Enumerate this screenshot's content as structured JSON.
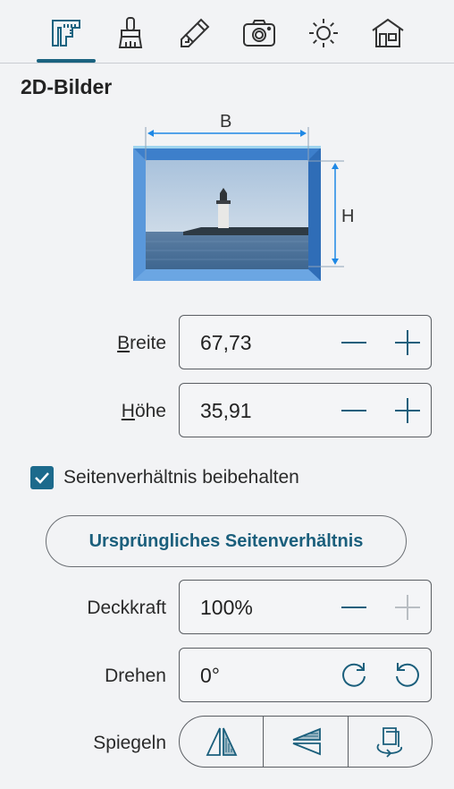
{
  "toolbar": {
    "tabs": [
      {
        "icon": "caliper-ruler-icon",
        "active": true
      },
      {
        "icon": "brush-icon"
      },
      {
        "icon": "pencil-eraser-icon"
      },
      {
        "icon": "camera-icon"
      },
      {
        "icon": "sun-icon"
      },
      {
        "icon": "house-icon"
      }
    ]
  },
  "section_title": "2D-Bilder",
  "preview": {
    "width_label": "B",
    "height_label": "H"
  },
  "width_row": {
    "label_underlined": "B",
    "label_rest": "reite",
    "value": "67,73"
  },
  "height_row": {
    "label_underlined": "H",
    "label_rest": "öhe",
    "value": "35,91"
  },
  "keep_ratio": {
    "label": "Seitenverhältnis beibehalten",
    "checked": true
  },
  "original_ratio_button": "Ursprüngliches Seitenverhältnis",
  "opacity_row": {
    "label": "Deckkraft",
    "value": "100%",
    "plus_disabled": true
  },
  "rotate_row": {
    "label": "Drehen",
    "value": "0°"
  },
  "mirror_row": {
    "label": "Spiegeln"
  },
  "colors": {
    "accent": "#1b6380",
    "frame": "#3d7fcb",
    "checkbox": "#1c6a8c"
  }
}
